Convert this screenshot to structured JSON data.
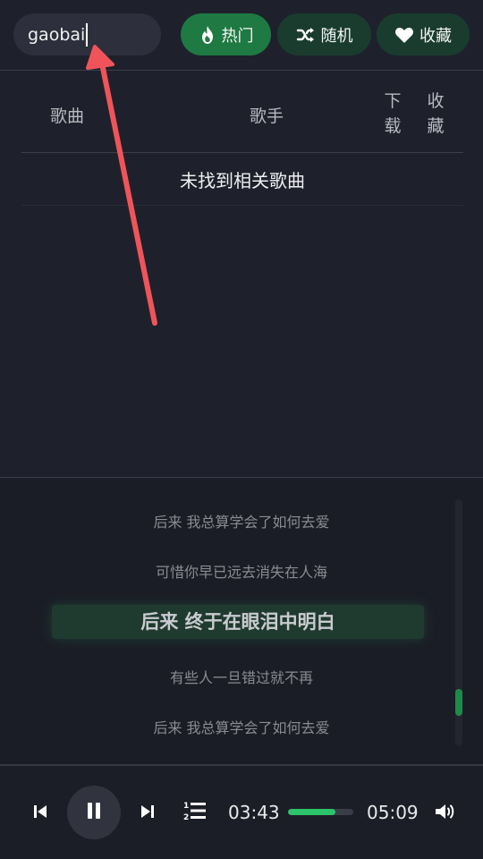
{
  "search": {
    "value": "gaobai",
    "icon": "text-cursor"
  },
  "buttons": {
    "hot": {
      "label": "热门",
      "icon": "flame-icon"
    },
    "random": {
      "label": "随机",
      "icon": "shuffle-icon"
    },
    "favorites": {
      "label": "收藏",
      "icon": "heart-icon"
    }
  },
  "table": {
    "headers": {
      "song": "歌曲",
      "singer": "歌手",
      "download": "下载",
      "favorite": "收藏"
    },
    "empty_message": "未找到相关歌曲"
  },
  "lyrics": {
    "lines": [
      "后来 我总算学会了如何去爱",
      "可惜你早已远去消失在人海",
      "后来 终于在眼泪中明白",
      "有些人一旦错过就不再",
      "后来 我总算学会了如何去爱"
    ],
    "active_index": 2
  },
  "player": {
    "current_time": "03:43",
    "total_time": "05:09",
    "progress_percent": 73,
    "state": "playing"
  },
  "colors": {
    "accent": "#1e7a42",
    "accent_dark": "#193c2e",
    "progress": "#2cc46a",
    "background": "#1e212c",
    "annotation_arrow": "#f0545a"
  }
}
